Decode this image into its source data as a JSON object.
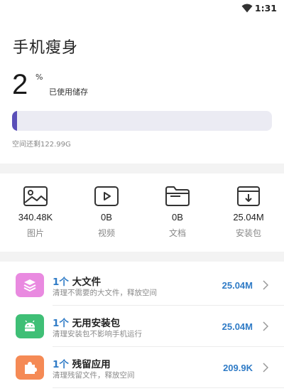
{
  "status_bar": {
    "time": "1:31",
    "wifi_icon": "wifi-icon"
  },
  "header": {
    "title": "手机瘦身",
    "used_percent": 2,
    "used_percent_text": "2",
    "percent_sign": "%",
    "used_label": "已使用储存",
    "remaining_text": "空间还剩122.99G",
    "colors": {
      "bar_fill": "#5a4fb8",
      "bar_track": "#ebebf3"
    }
  },
  "categories": [
    {
      "icon": "image-icon",
      "size": "340.48K",
      "label": "图片"
    },
    {
      "icon": "video-icon",
      "size": "0B",
      "label": "视频"
    },
    {
      "icon": "folder-icon",
      "size": "0B",
      "label": "文档"
    },
    {
      "icon": "package-download-icon",
      "size": "25.04M",
      "label": "安装包"
    }
  ],
  "clean_items": [
    {
      "icon": "stack-layers-icon",
      "icon_color": "#e98ae0",
      "count": "1个",
      "title": " 大文件",
      "desc": "清理不需要的大文件，释放空间",
      "size": "25.04M"
    },
    {
      "icon": "android-icon",
      "icon_color": "#3fbf76",
      "count": "1个",
      "title": " 无用安装包",
      "desc": "清理安装包不影响手机运行",
      "size": "25.04M"
    },
    {
      "icon": "puzzle-icon",
      "icon_color": "#f58a55",
      "count": "1个",
      "title": " 残留应用",
      "desc": "清理残留文件，释放空间",
      "size": "209.9K"
    }
  ],
  "accent_color": "#2f7bc6"
}
